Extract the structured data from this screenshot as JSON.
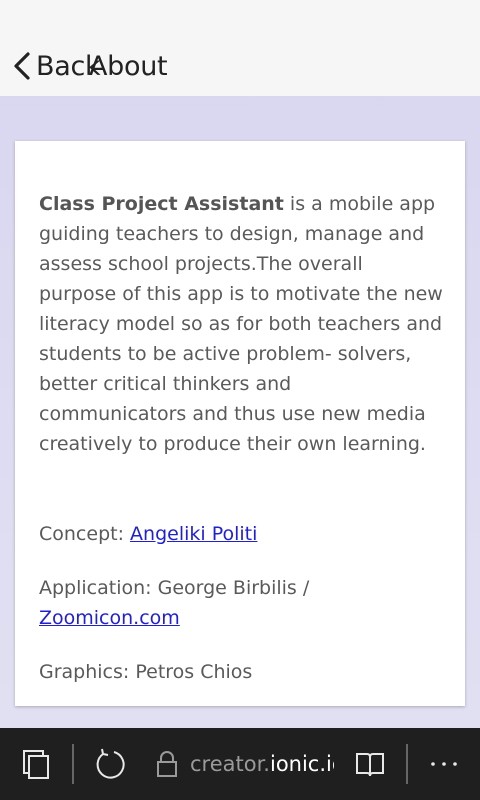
{
  "header": {
    "back_label": "Back",
    "title": "About"
  },
  "card": {
    "intro_bold": "Class Project Assistant",
    "intro_rest": " is a mobile app guiding teachers to design, manage and assess school projects.The overall purpose of this app is to motivate the new literacy model so as for both teachers and students to be active problem- solvers, better critical thinkers and communicators and thus use new media creatively to produce their own learning.",
    "concept_label": "Concept: ",
    "concept_link": "Angeliki Politi",
    "application_label": "Application: George Birbilis / ",
    "application_link": "Zoomicon.com",
    "graphics": "Graphics: Petros Chios"
  },
  "browser_bar": {
    "url_prefix": "creator.",
    "url_host": "ionic.io",
    "icons": [
      "tabs-icon",
      "refresh-icon",
      "lock-icon",
      "reading-view-icon",
      "more-icon"
    ]
  },
  "colors": {
    "header_bg": "#f6f6f6",
    "page_bg": "#dcdaf1",
    "link": "#1f1fd6",
    "bottom_bar_bg": "#1f1f1f"
  }
}
